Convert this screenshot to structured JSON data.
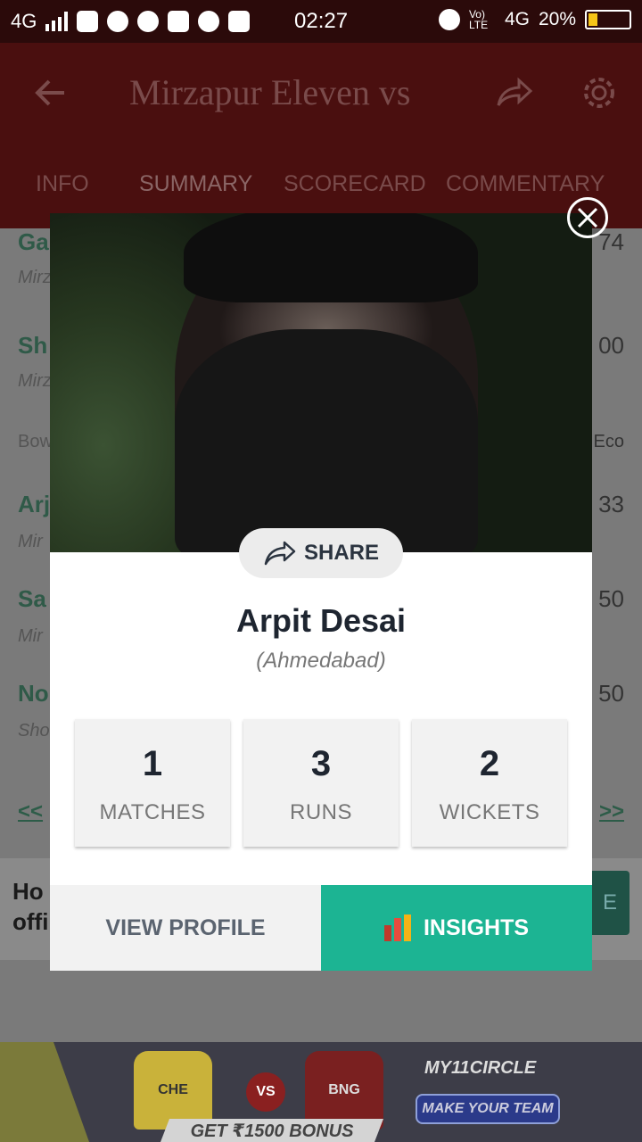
{
  "status_bar": {
    "network": "4G",
    "time": "02:27",
    "volte": "Vo) LTE",
    "network_right": "4G",
    "battery": "20%"
  },
  "app_bar": {
    "title": "Mirzapur Eleven vs"
  },
  "tabs": [
    {
      "label": "INFO"
    },
    {
      "label": "SUMMARY"
    },
    {
      "label": "SCORECARD"
    },
    {
      "label": "COMMENTARY"
    }
  ],
  "background_rows": [
    {
      "name": "Ga",
      "sub": "Mirz",
      "num": "74"
    },
    {
      "name": "Sh",
      "sub": "Mirz",
      "num": "00"
    },
    {
      "name": "Bow",
      "sub": "",
      "num": "Eco"
    },
    {
      "name": "Arj",
      "sub": "Mir",
      "num": "33"
    },
    {
      "name": "Sa",
      "sub": "Mir",
      "num": "50"
    },
    {
      "name": "No",
      "sub": "Sho",
      "num": "50"
    }
  ],
  "background_links": {
    "prev": "<<",
    "next": ">>"
  },
  "background_banner": {
    "line1": "Ho",
    "line2": "offi",
    "button": "E"
  },
  "ad": {
    "team1": "CHE",
    "vs": "VS",
    "team2": "BNG",
    "bonus": "GET ₹1500 BONUS",
    "brand": "MY11CIRCLE",
    "cta": "MAKE YOUR TEAM"
  },
  "modal": {
    "share_label": "SHARE",
    "player_name": "Arpit Desai",
    "team": "(Ahmedabad)",
    "stats": [
      {
        "value": "1",
        "label": "MATCHES"
      },
      {
        "value": "3",
        "label": "RUNS"
      },
      {
        "value": "2",
        "label": "WICKETS"
      }
    ],
    "view_profile_label": "VIEW PROFILE",
    "insights_label": "INSIGHTS"
  },
  "colors": {
    "insights": "#1cb493",
    "header": "#4a0f0f"
  }
}
